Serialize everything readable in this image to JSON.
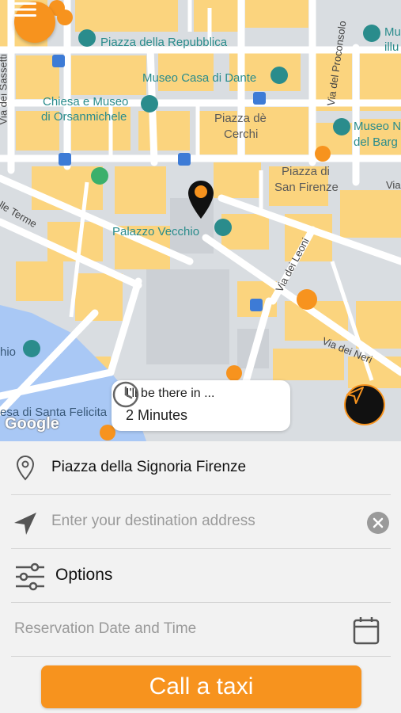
{
  "map": {
    "labels": {
      "piazza_repubblica": "Piazza della Repubblica",
      "museo_dante": "Museo Casa di Dante",
      "orsanmichele_1": "Chiesa e Museo",
      "orsanmichele_2": "di Orsanmichele",
      "piazza_cerchi_1": "Piazza dè",
      "piazza_cerchi_2": "Cerchi",
      "museo_bargello_1": "Museo N",
      "museo_bargello_2": "del Barg",
      "piazza_firenze_1": "Piazza di",
      "piazza_firenze_2": "San Firenze",
      "palazzo_vecchio": "Palazzo Vecchio",
      "santa_felicita": "esa di Santa Felicita",
      "museo_top_right_1": "Mu",
      "museo_top_right_2": "illu",
      "left_hio": "hio"
    },
    "streets": {
      "via_sassetti": "Via dei Sassetti",
      "via_proconsolo": "Via del Proconsolo",
      "via_leoni": "Via dei Leoni",
      "via_neri": "Via dei Neri",
      "via_terme": "lle Terme",
      "via_right": "Via"
    },
    "google": "Google"
  },
  "eta": {
    "label": "I'll be there in ...",
    "value": "2 Minutes"
  },
  "form": {
    "pickup": "Piazza della Signoria Firenze",
    "destination_placeholder": "Enter your destination address",
    "options": "Options",
    "reservation_placeholder": "Reservation Date and Time"
  },
  "call_button": "Call a taxi",
  "colors": {
    "accent": "#f7931e",
    "block": "#fbd47e",
    "road": "#ffffff",
    "water": "#a9c8f5",
    "poi": "#2a8c8c"
  }
}
